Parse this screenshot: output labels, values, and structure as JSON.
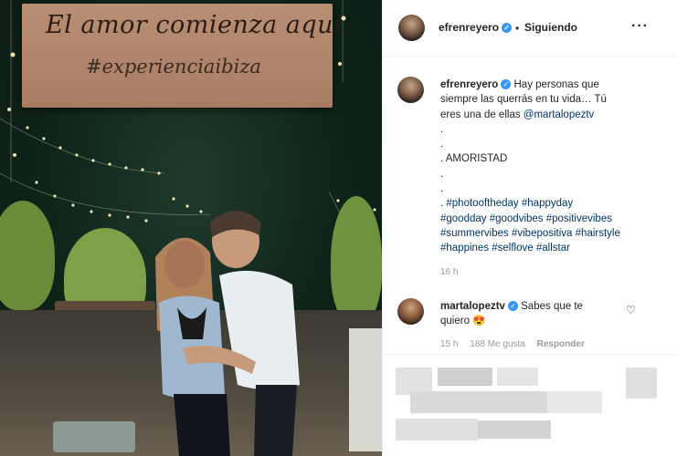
{
  "photo": {
    "sign_line1": "El amor comienza aquí",
    "sign_line2": "#experienciaibiza"
  },
  "header": {
    "username": "efrenreyero",
    "separator": "•",
    "follow_status": "Siguiendo",
    "more_glyph": "···"
  },
  "caption": {
    "username": "efrenreyero",
    "line1": "Hay personas que",
    "line2": "siempre las querrás en tu vida… Tú",
    "line3a": "eres una de ellas ",
    "mention": "@martalopeztv",
    "dot1": ".",
    "dot2": ".",
    "line_amor": ". AMORISTAD",
    "dot3": ".",
    "dot4": ".",
    "hashtags": [
      ". #photooftheday #happyday",
      "#goodday #goodvibes #positivevibes",
      "#summervibes #vibepositiva #hairstyle",
      "#happines #selflove #allstar"
    ],
    "time": "16 h"
  },
  "comment": {
    "username": "martalopeztv",
    "text1": "Sabes que te",
    "text2": "quiero",
    "emoji": "😍",
    "time": "15 h",
    "likes": "188 Me gusta",
    "reply": "Responder",
    "heart_glyph": "♡"
  },
  "icons": {
    "verified_glyph": "✓"
  },
  "colors": {
    "link_blue": "#003569",
    "verified_blue": "#3897f0",
    "muted": "#999999"
  }
}
